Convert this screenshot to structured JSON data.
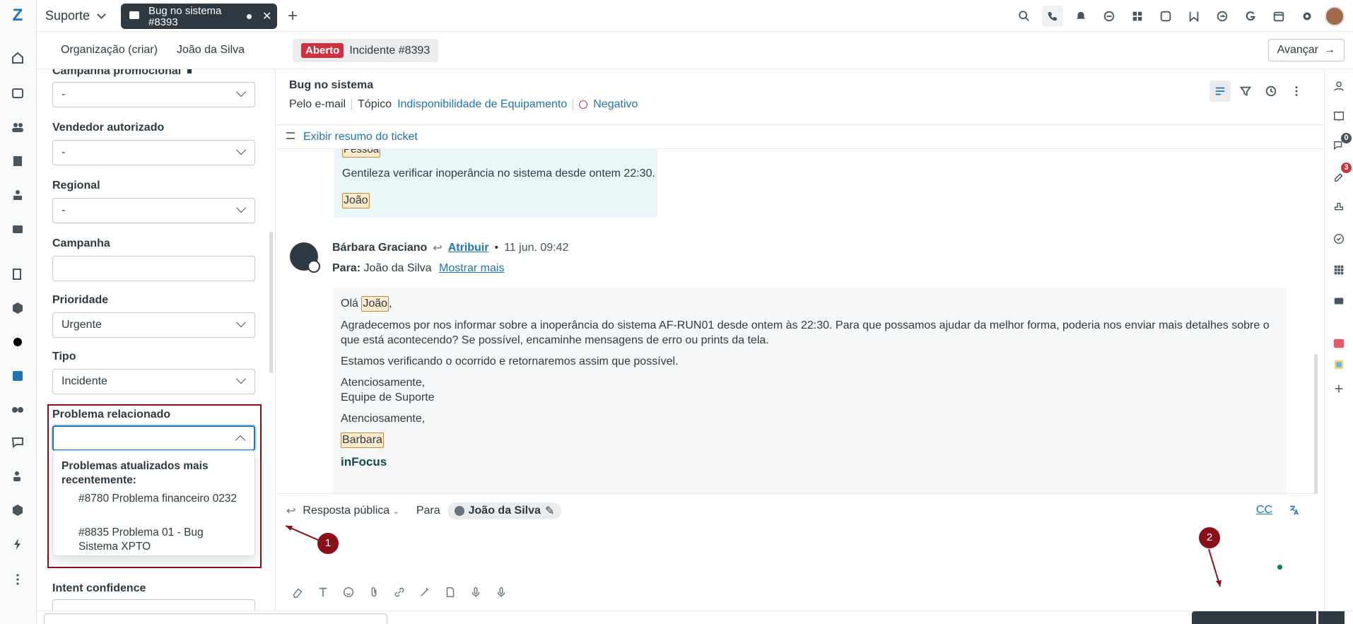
{
  "topbar": {
    "brand": "Suporte",
    "doc_tab_title": "Bug no sistema",
    "doc_tab_subtitle": "#8393",
    "icons": [
      "search-icon",
      "phone-icon",
      "bell-icon",
      "app-icon",
      "grid-apps-icon",
      "whatsapp-icon",
      "app-w-icon",
      "app-arrow-icon",
      "app-g-icon",
      "calendar-icon",
      "settings-icon",
      "user-avatar"
    ]
  },
  "subbar": {
    "org_tab": "Organização (criar)",
    "user_tab": "João da Silva",
    "status_badge": "Aberto",
    "incident_tab": "Incidente #8393",
    "advance_button": "Avançar"
  },
  "properties": {
    "campaign_promo_label": "Campanha promocional",
    "campaign_promo_value": "-",
    "seller_label": "Vendedor autorizado",
    "seller_value": "-",
    "regional_label": "Regional",
    "regional_value": "-",
    "campaign_label": "Campanha",
    "campaign_value": "",
    "priority_label": "Prioridade",
    "priority_value": "Urgente",
    "type_label": "Tipo",
    "type_value": "Incidente",
    "related_problem_label": "Problema relacionado",
    "related_problem_value": "",
    "dropdown": {
      "group_label": "Problemas atualizados mais recentemente:",
      "options": [
        "#8780 Problema financeiro 0232",
        "#8835 Problema 01  - Bug Sistema XPTO"
      ]
    },
    "intent_confidence_label": "Intent confidence"
  },
  "ticket": {
    "title": "Bug no sistema",
    "channel": "Pelo e-mail",
    "topic_label": "Tópico",
    "topic_value": "Indisponibilidade de Equipamento",
    "sentiment": "Negativo",
    "summary_link": "Exibir resumo do ticket"
  },
  "conversation": {
    "customer_message": {
      "tag_top": "Pessoa",
      "text": "Gentileza verificar inoperância no sistema desde ontem 22:30.",
      "signature_tag": "João"
    },
    "agent_message": {
      "author": "Bárbara Graciano",
      "assign_link": "Atribuir",
      "timestamp": "11 jun. 09:42",
      "to_label": "Para:",
      "to_value": "João da Silva",
      "show_more": "Mostrar mais",
      "greeting": "Olá",
      "greeting_tag": "João",
      "paragraph1": "Agradecemos por nos informar sobre a inoperância do sistema AF-RUN01 desde ontem às 22:30. Para que possamos ajudar da melhor forma, poderia nos enviar mais detalhes sobre o que está acontecendo? Se possível, encaminhe mensagens de erro ou prints da tela.",
      "paragraph2": "Estamos verificando o ocorrido e retornaremos assim que possível.",
      "closing1": "Atenciosamente,",
      "closing1b": "Equipe de Suporte",
      "closing2": "Atenciosamente,",
      "signature_tag": "Barbara",
      "logo_text": "inFocus"
    }
  },
  "composer": {
    "mode": "Resposta pública",
    "to_label": "Para",
    "to_value": "João da Silva",
    "cc_label": "CC"
  },
  "rside": {
    "badge_chat": "0",
    "badge_tasks": "3"
  },
  "annotations": {
    "marker1": "1",
    "marker2": "2"
  }
}
